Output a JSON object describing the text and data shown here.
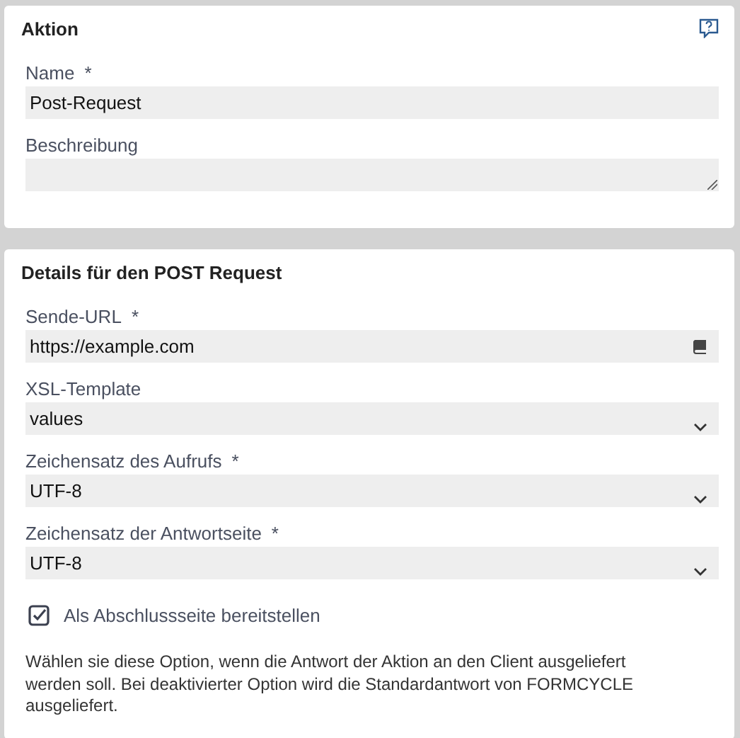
{
  "panels": [
    {
      "title": "Aktion",
      "help": true,
      "fields": [
        {
          "kind": "text",
          "label": "Name",
          "required_mark": "*",
          "value": "Post-Request"
        },
        {
          "kind": "textarea",
          "label": "Beschreibung"
        }
      ]
    },
    {
      "title": "Details für den POST Request",
      "help": false,
      "fields": [
        {
          "kind": "text_with_icon",
          "label": "Sende-URL",
          "required_mark": "*",
          "value": "https://example.com"
        },
        {
          "kind": "select",
          "label": "XSL-Template",
          "value": "values"
        },
        {
          "kind": "select",
          "label": "Zeichensatz des Aufrufs",
          "required_mark": "*",
          "value": "UTF-8"
        },
        {
          "kind": "select",
          "label": "Zeichensatz der Antwortseite",
          "required_mark": "*",
          "value": "UTF-8"
        },
        {
          "kind": "checkbox",
          "label": "Als Abschlussseite bereitstellen",
          "checked": true
        },
        {
          "kind": "note",
          "text": "Wählen sie diese Option, wenn die Antwort der Aktion an den Client ausgeliefert werden soll. Bei deaktivierter Option wird die Standardantwort von FORMCYCLE ausgeliefert."
        }
      ]
    }
  ]
}
